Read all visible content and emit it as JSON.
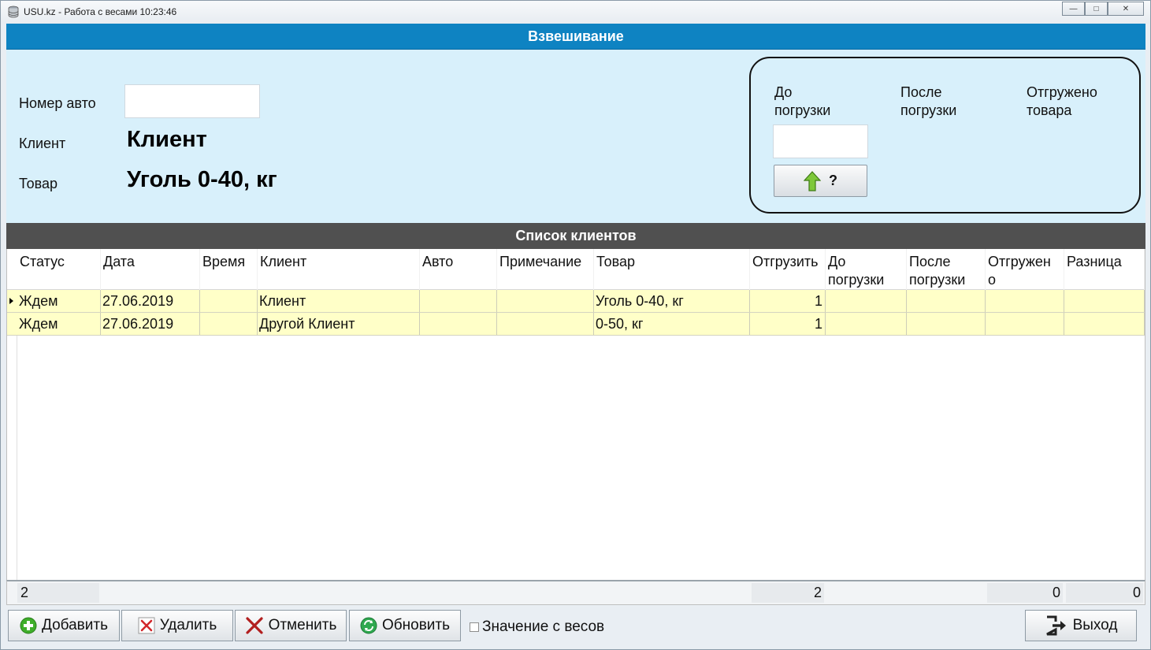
{
  "window": {
    "title": "USU.kz - Работа с весами 10:23:46",
    "minimize": "—",
    "maximize": "□",
    "close": "✕"
  },
  "weighing": {
    "header": "Взвешивание",
    "car_number_label": "Номер авто",
    "car_number_value": "",
    "client_label": "Клиент",
    "client_value": "Клиент",
    "product_label": "Товар",
    "product_value": "Уголь 0-40, кг",
    "before_label_1": "До",
    "before_label_2": "погрузки",
    "after_label_1": "После",
    "after_label_2": "погрузки",
    "shipped_label_1": "Отгружено",
    "shipped_label_2": "товара",
    "before_value": "",
    "query_button": "?"
  },
  "list": {
    "header": "Список клиентов",
    "columns": [
      {
        "line1": "Статус",
        "line2": ""
      },
      {
        "line1": "Дата",
        "line2": ""
      },
      {
        "line1": "Время",
        "line2": ""
      },
      {
        "line1": "Клиент",
        "line2": ""
      },
      {
        "line1": "Авто",
        "line2": ""
      },
      {
        "line1": "Примечание",
        "line2": ""
      },
      {
        "line1": "Товар",
        "line2": ""
      },
      {
        "line1": "Отгрузить",
        "line2": ""
      },
      {
        "line1": "До",
        "line2": "погрузки"
      },
      {
        "line1": "После",
        "line2": "погрузки"
      },
      {
        "line1": "Отгружен",
        "line2": "о"
      },
      {
        "line1": "Разница",
        "line2": ""
      }
    ],
    "rows": [
      {
        "status": "Ждем",
        "date": "27.06.2019",
        "time": "",
        "client": "Клиент",
        "auto": "",
        "note": "",
        "product": "Уголь 0-40, кг",
        "ship": "1",
        "before": "",
        "after": "",
        "shipped": "",
        "diff": ""
      },
      {
        "status": "Ждем",
        "date": "27.06.2019",
        "time": "",
        "client": "Другой Клиент",
        "auto": "",
        "note": "",
        "product": "0-50, кг",
        "ship": "1",
        "before": "",
        "after": "",
        "shipped": "",
        "diff": ""
      }
    ],
    "footer": {
      "count": "2",
      "ship_total": "2",
      "shipped_total": "0",
      "diff_total": "0"
    }
  },
  "toolbar": {
    "add": "Добавить",
    "delete": "Удалить",
    "cancel": "Отменить",
    "refresh": "Обновить",
    "scale_value": "Значение с весов",
    "exit": "Выход"
  },
  "colors": {
    "header_blue": "#0e83c2",
    "panel_blue": "#d8f0fb",
    "list_header": "#505050",
    "row_yellow": "#ffffc8"
  }
}
